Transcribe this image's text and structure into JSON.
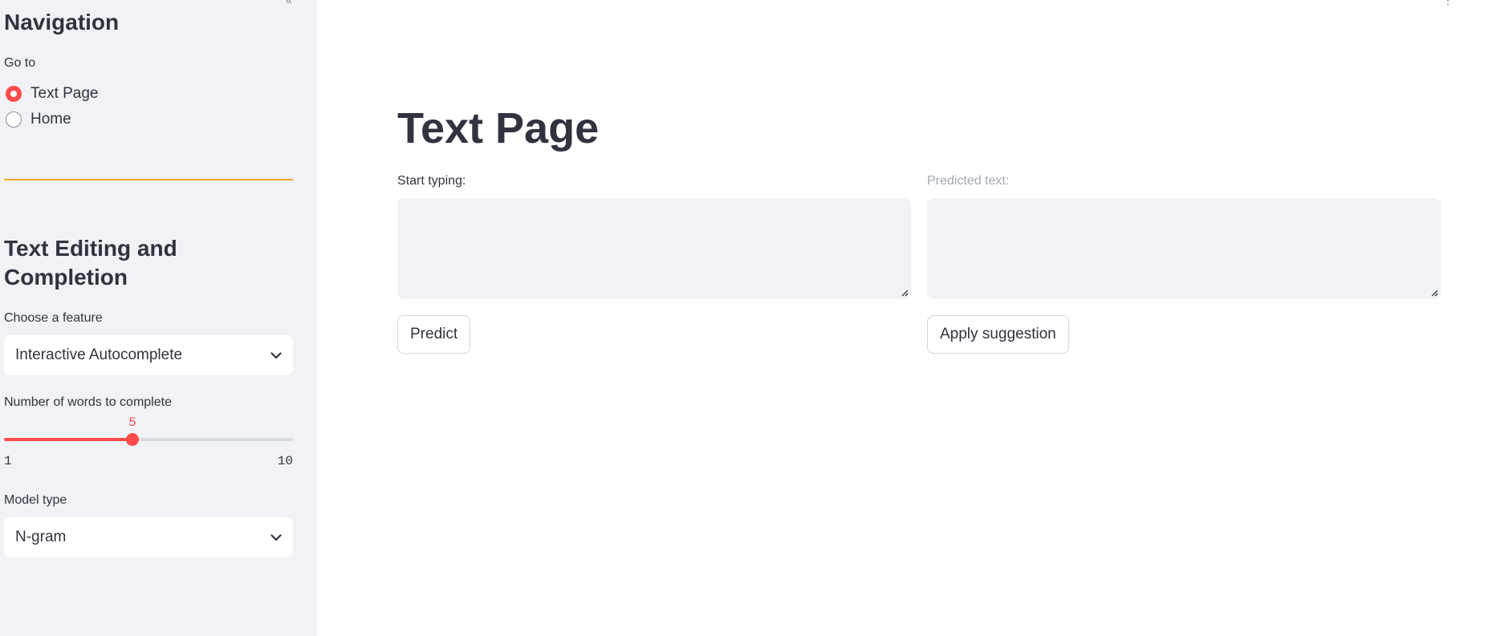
{
  "sidebar": {
    "nav_heading": "Navigation",
    "goto_label": "Go to",
    "pages": [
      {
        "label": "Text Page",
        "selected": true
      },
      {
        "label": "Home",
        "selected": false
      }
    ],
    "section_heading": "Text Editing and Completion",
    "feature": {
      "label": "Choose a feature",
      "value": "Interactive Autocomplete"
    },
    "words_slider": {
      "label": "Number of words to complete",
      "min": 1,
      "max": 10,
      "value": 5
    },
    "model": {
      "label": "Model type",
      "value": "N-gram"
    }
  },
  "main": {
    "title": "Text Page",
    "input": {
      "label": "Start typing:",
      "value": ""
    },
    "output": {
      "label": "Predicted text:",
      "value": ""
    },
    "predict_button": "Predict",
    "apply_button": "Apply suggestion"
  },
  "colors": {
    "accent": "#ff4b4b",
    "divider": "#ffa421",
    "sidebar_bg": "#f0f2f6",
    "text": "#31333f"
  }
}
